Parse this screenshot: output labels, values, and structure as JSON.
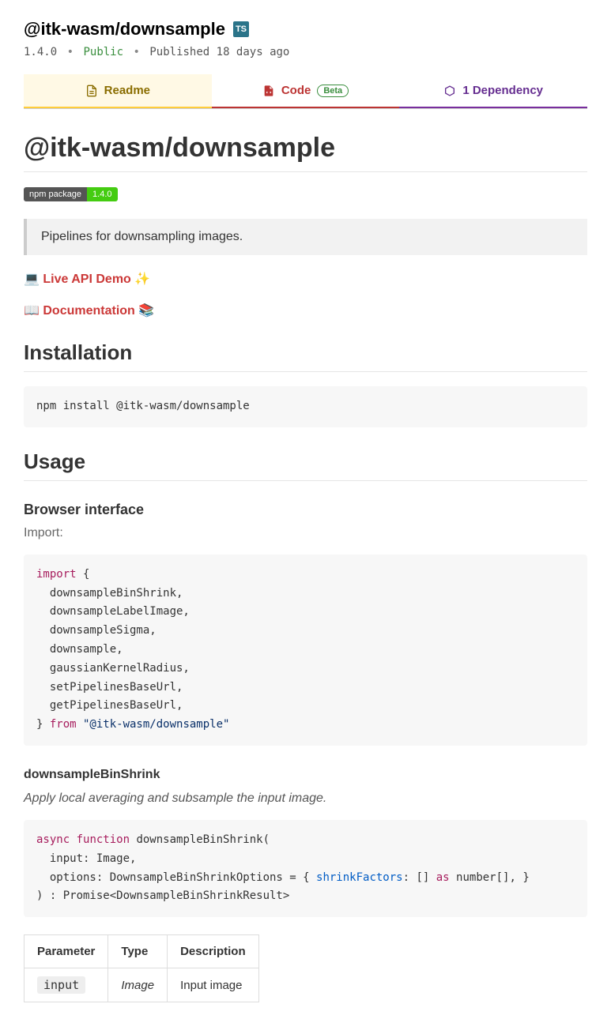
{
  "header": {
    "package_name": "@itk-wasm/downsample",
    "ts_badge": "TS",
    "version": "1.4.0",
    "visibility": "Public",
    "published": "Published 18 days ago"
  },
  "tabs": {
    "readme": "Readme",
    "code": "Code",
    "code_beta": "Beta",
    "dep": "1 Dependency"
  },
  "readme": {
    "title": "@itk-wasm/downsample",
    "npm_badge_left": "npm package",
    "npm_badge_right": "1.4.0",
    "blockquote": "Pipelines for downsampling images.",
    "live_demo_prefix": "💻 ",
    "live_demo_link": "Live API Demo",
    "live_demo_suffix": " ✨",
    "docs_prefix": "📖 ",
    "docs_link": "Documentation",
    "docs_suffix": " 📚",
    "installation_heading": "Installation",
    "install_cmd": "npm install @itk-wasm/downsample",
    "usage_heading": "Usage",
    "browser_heading": "Browser interface",
    "import_label": "Import:",
    "import_code": {
      "kw_import": "import",
      "brace_open": " {",
      "items": [
        "  downsampleBinShrink,",
        "  downsampleLabelImage,",
        "  downsampleSigma,",
        "  downsample,",
        "  gaussianKernelRadius,",
        "  setPipelinesBaseUrl,",
        "  getPipelinesBaseUrl,"
      ],
      "brace_close": "} ",
      "kw_from": "from",
      "pkg_str": " \"@itk-wasm/downsample\""
    },
    "fn_name": "downsampleBinShrink",
    "fn_desc": "Apply local averaging and subsample the input image.",
    "fn_code": {
      "kw_async": "async",
      "kw_function": " function",
      "sig_open": " downsampleBinShrink(",
      "line_input": "  input: Image,",
      "line_opts_pre": "  options: DownsampleBinShrinkOptions = { ",
      "prop_shrink": "shrinkFactors",
      "line_opts_mid": ": [] ",
      "kw_as": "as",
      "line_opts_post": " number[], }",
      "sig_close": ") : Promise<DownsampleBinShrinkResult>"
    },
    "table": {
      "h1": "Parameter",
      "h2": "Type",
      "h3": "Description",
      "r1c1": "input",
      "r1c2": "Image",
      "r1c3": "Input image"
    }
  }
}
